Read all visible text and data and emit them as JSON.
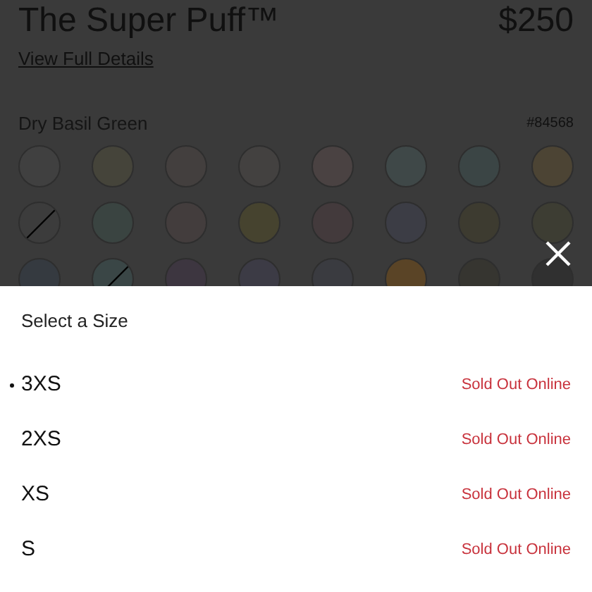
{
  "product": {
    "title": "The Super Puff™",
    "price": "$250",
    "details_link": "View Full Details"
  },
  "color_picker": {
    "name": "Dry Basil Green",
    "code": "#84568",
    "swatches": [
      {
        "color": "#404040",
        "crossed": false
      },
      {
        "color": "#45443a",
        "crossed": false
      },
      {
        "color": "#433f3e",
        "crossed": false
      },
      {
        "color": "#434140",
        "crossed": false
      },
      {
        "color": "#4a4242",
        "crossed": false
      },
      {
        "color": "#3f4848",
        "crossed": false
      },
      {
        "color": "#3b4545",
        "crossed": false
      },
      {
        "color": "#4c4434",
        "crossed": false
      },
      {
        "color": "#3c3c3c",
        "crossed": true
      },
      {
        "color": "#3a4441",
        "crossed": false
      },
      {
        "color": "#433d3d",
        "crossed": false
      },
      {
        "color": "#46432f",
        "crossed": false
      },
      {
        "color": "#433a3c",
        "crossed": false
      },
      {
        "color": "#3c3d45",
        "crossed": false
      },
      {
        "color": "#3d3b30",
        "crossed": false
      },
      {
        "color": "#3d3d33",
        "crossed": false
      },
      {
        "color": "#353a40",
        "crossed": false
      },
      {
        "color": "#3a4646",
        "crossed": true
      },
      {
        "color": "#3d3640",
        "crossed": false
      },
      {
        "color": "#3c3b45",
        "crossed": false
      },
      {
        "color": "#3a3b40",
        "crossed": false
      },
      {
        "color": "#5a4426",
        "crossed": false
      },
      {
        "color": "#363530",
        "crossed": false
      },
      {
        "color": "#303030",
        "crossed": false
      }
    ]
  },
  "size_sheet": {
    "title": "Select a Size",
    "sizes": [
      {
        "label": "3XS",
        "status": "Sold Out Online",
        "selected": true
      },
      {
        "label": "2XS",
        "status": "Sold Out Online",
        "selected": false
      },
      {
        "label": "XS",
        "status": "Sold Out Online",
        "selected": false
      },
      {
        "label": "S",
        "status": "Sold Out Online",
        "selected": false
      }
    ]
  }
}
